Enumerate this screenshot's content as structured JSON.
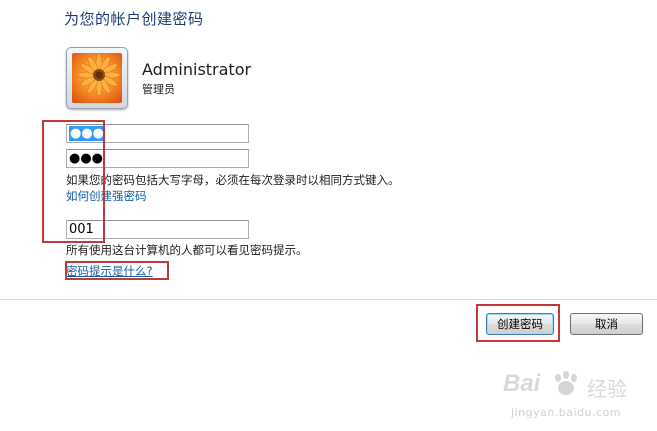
{
  "page": {
    "title": "为您的帐户创建密码"
  },
  "user": {
    "name": "Administrator",
    "role": "管理员",
    "avatar_icon": "user-flower-avatar-icon"
  },
  "form": {
    "new_password_value": "●●●",
    "confirm_password_value": "●●●",
    "caps_note": "如果您的密码包括大写字母，必须在每次登录时以相同方式键入。",
    "strong_password_link": "如何创建强密码",
    "hint_value": "001",
    "hint_note": "所有使用这台计算机的人都可以看见密码提示。",
    "hint_link": "密码提示是什么?"
  },
  "buttons": {
    "create": "创建密码",
    "cancel": "取消"
  },
  "watermark": {
    "brand_left": "Bai",
    "brand_right": "经验",
    "url": "jingyan.baidu.com"
  },
  "colors": {
    "title": "#1e3c78",
    "link": "#0f5ea8",
    "selection": "#3399ff",
    "annotation": "#c0393b"
  }
}
